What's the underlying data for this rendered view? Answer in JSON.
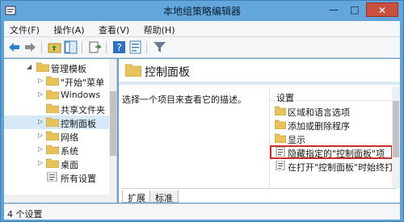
{
  "window": {
    "title": "本地组策略编辑器"
  },
  "menubar": [
    "文件(F)",
    "操作(A)",
    "查看(V)",
    "帮助(H)"
  ],
  "tree": {
    "items": [
      {
        "label": "管理模板",
        "depth": 0,
        "expander": "open"
      },
      {
        "label": "\"开始\"菜单",
        "depth": 1,
        "expander": "closed"
      },
      {
        "label": "Windows",
        "depth": 1,
        "expander": "closed"
      },
      {
        "label": "共享文件夹",
        "depth": 1,
        "expander": "none"
      },
      {
        "label": "控制面板",
        "depth": 1,
        "expander": "closed",
        "selected": true
      },
      {
        "label": "网络",
        "depth": 1,
        "expander": "closed"
      },
      {
        "label": "系统",
        "depth": 1,
        "expander": "closed"
      },
      {
        "label": "桌面",
        "depth": 1,
        "expander": "closed"
      },
      {
        "label": "所有设置",
        "depth": 1,
        "expander": "none"
      }
    ]
  },
  "right": {
    "title": "控制面板",
    "description": "选择一个项目来查看它的描述。",
    "list_header": "设置",
    "items": [
      {
        "label": "区域和语言选项",
        "icon": "folder-icon",
        "highlighted": false
      },
      {
        "label": "添加或删除程序",
        "icon": "folder-icon",
        "highlighted": false
      },
      {
        "label": "显示",
        "icon": "folder-icon",
        "highlighted": false
      },
      {
        "label": "隐藏指定的\"控制面板\"项",
        "icon": "policy-icon",
        "highlighted": true
      },
      {
        "label": "在打开\"控制面板\"时始终打",
        "icon": "policy-icon",
        "highlighted": false
      }
    ],
    "tabs": [
      "扩展",
      "标准"
    ]
  },
  "statusbar": {
    "text": "4 个设置"
  },
  "colors": {
    "title_bar": "#63a6dc",
    "close_button": "#c7503e",
    "highlight_border": "#c9302c",
    "folder": "#e8c25a"
  }
}
